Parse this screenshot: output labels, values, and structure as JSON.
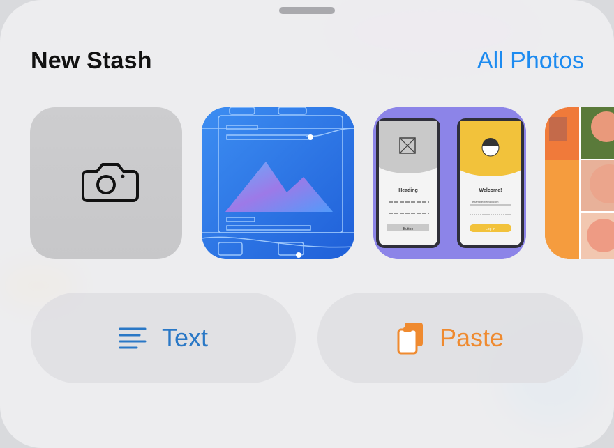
{
  "sheet": {
    "title": "New Stash",
    "all_photos_label": "All Photos"
  },
  "thumbnails": {
    "camera": {
      "icon": "camera-icon"
    },
    "wireframe_a": {
      "heading": "Heading",
      "button": "Button"
    },
    "wireframe_b": {
      "welcome": "Welcome!",
      "email": "example@email.com",
      "login": "Log In"
    }
  },
  "actions": {
    "text_label": "Text",
    "paste_label": "Paste"
  },
  "colors": {
    "accent_blue": "#1d8bf0",
    "text_blue": "#2a78c6",
    "paste_orange": "#ef8a2f"
  }
}
